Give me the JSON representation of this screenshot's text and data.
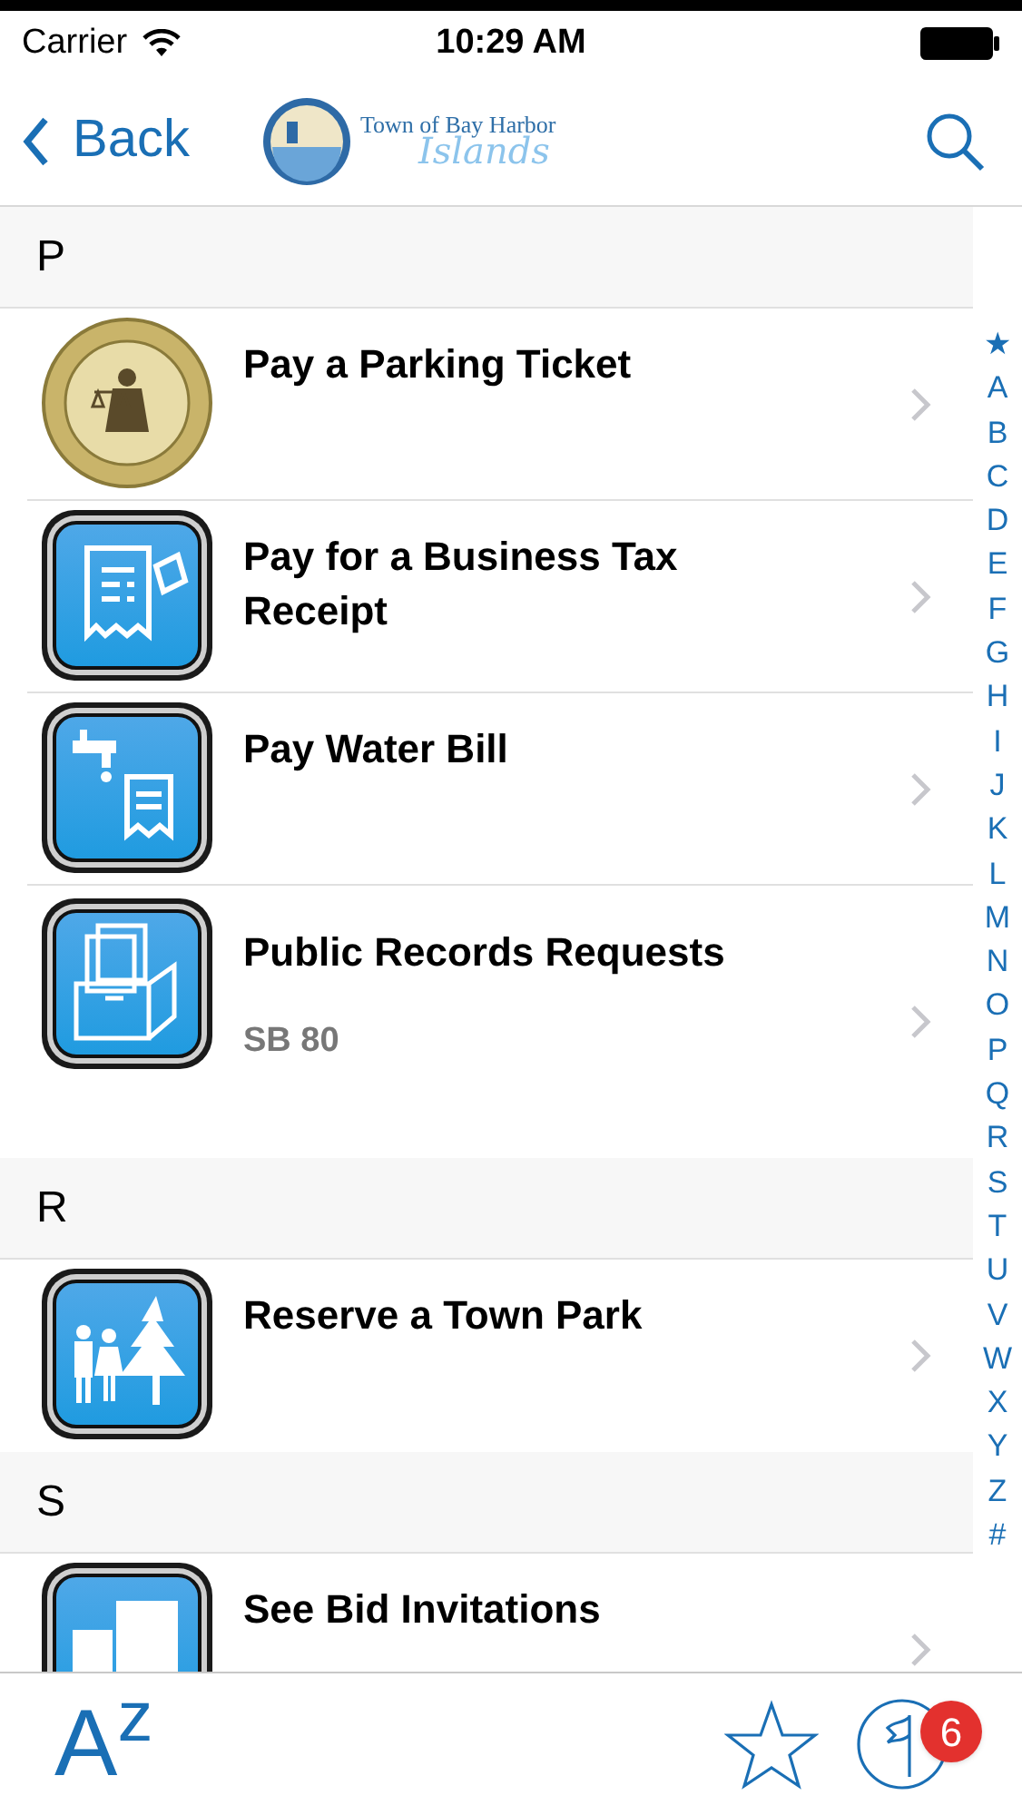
{
  "status_bar": {
    "carrier": "Carrier",
    "time": "10:29 AM"
  },
  "nav": {
    "back": "Back",
    "logo": {
      "line1": "Town of Bay Harbor",
      "line2": "Islands"
    }
  },
  "sections": [
    {
      "letter": "P",
      "items": [
        {
          "title": "Pay a Parking Ticket",
          "kind": "seal"
        },
        {
          "title": "Pay for a Business Tax Receipt",
          "kind": "receipt"
        },
        {
          "title": "Pay Water Bill",
          "kind": "water"
        },
        {
          "title": "Public Records Requests",
          "subtitle": "SB 80",
          "kind": "records"
        }
      ]
    },
    {
      "letter": "R",
      "items": [
        {
          "title": "Reserve a Town Park",
          "kind": "park"
        }
      ]
    },
    {
      "letter": "S",
      "items": [
        {
          "title": "See Bid Invitations",
          "kind": "bid"
        }
      ]
    }
  ],
  "index": [
    "★",
    "A",
    "B",
    "C",
    "D",
    "E",
    "F",
    "G",
    "H",
    "I",
    "J",
    "K",
    "L",
    "M",
    "N",
    "O",
    "P",
    "Q",
    "R",
    "S",
    "T",
    "U",
    "V",
    "W",
    "X",
    "Y",
    "Z",
    "#"
  ],
  "tab_bar": {
    "az": "A$^{z}$",
    "badge": "6"
  }
}
